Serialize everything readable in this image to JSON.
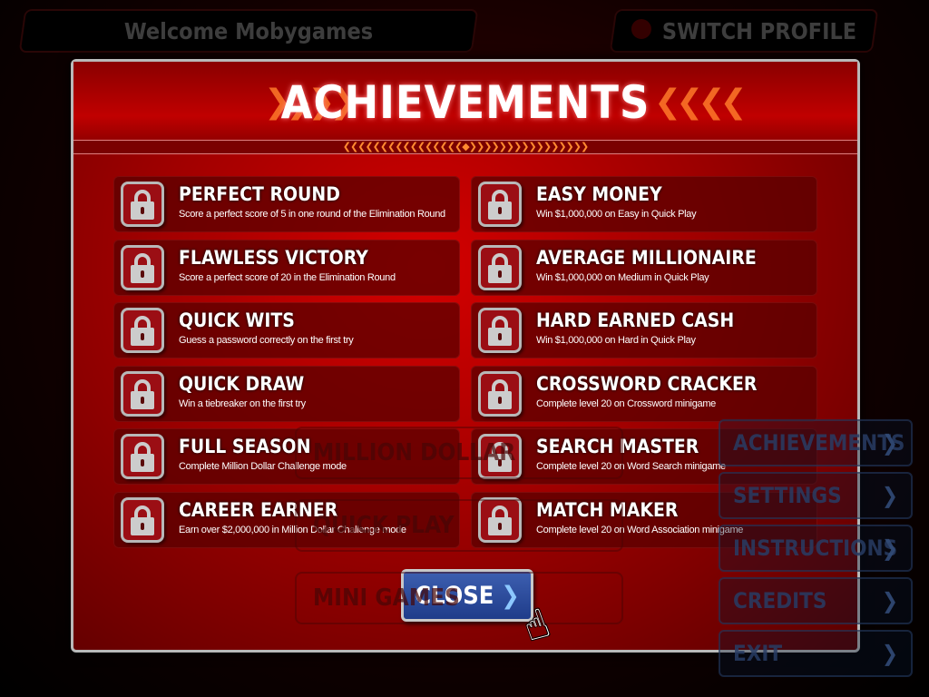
{
  "header": {
    "welcome": "Welcome Mobygames",
    "switch_profile": "SWITCH PROFILE"
  },
  "background_menu": {
    "left": [
      "MILLION DOLLAR",
      "QUICK PLAY",
      "MINI GAMES"
    ],
    "right": [
      "ACHIEVEMENTS",
      "SETTINGS",
      "INSTRUCTIONS",
      "CREDITS",
      "EXIT"
    ],
    "chevron": "❯"
  },
  "modal": {
    "title": "ACHIEVEMENTS",
    "close_label": "CLOSE",
    "close_arrow": "❯",
    "achievements_left": [
      {
        "name": "PERFECT ROUND",
        "desc": "Score a perfect score of 5 in one round of the Elimination Round",
        "locked": true
      },
      {
        "name": "FLAWLESS VICTORY",
        "desc": "Score a perfect score of 20 in the Elimination Round",
        "locked": true
      },
      {
        "name": "QUICK WITS",
        "desc": "Guess a password correctly on the first try",
        "locked": true
      },
      {
        "name": "QUICK DRAW",
        "desc": "Win a tiebreaker on the first try",
        "locked": true
      },
      {
        "name": "FULL SEASON",
        "desc": "Complete Million Dollar Challenge mode",
        "locked": true
      },
      {
        "name": "CAREER EARNER",
        "desc": "Earn over $2,000,000 in Million Dollar Challenge mode",
        "locked": true
      }
    ],
    "achievements_right": [
      {
        "name": "EASY MONEY",
        "desc": "Win $1,000,000 on Easy in Quick Play",
        "locked": true
      },
      {
        "name": "AVERAGE MILLIONAIRE",
        "desc": "Win $1,000,000 on Medium in Quick Play",
        "locked": true
      },
      {
        "name": "HARD EARNED CASH",
        "desc": "Win $1,000,000 on Hard in Quick Play",
        "locked": true
      },
      {
        "name": "CROSSWORD CRACKER",
        "desc": "Complete level 20 on Crossword minigame",
        "locked": true
      },
      {
        "name": "SEARCH MASTER",
        "desc": "Complete level 20 on Word Search minigame",
        "locked": true
      },
      {
        "name": "MATCH MAKER",
        "desc": "Complete level 20 on Word Association minigame",
        "locked": true
      }
    ]
  },
  "colors": {
    "modal_red": "#c00000",
    "close_blue": "#2c4c9c",
    "card": "#5a0000"
  }
}
